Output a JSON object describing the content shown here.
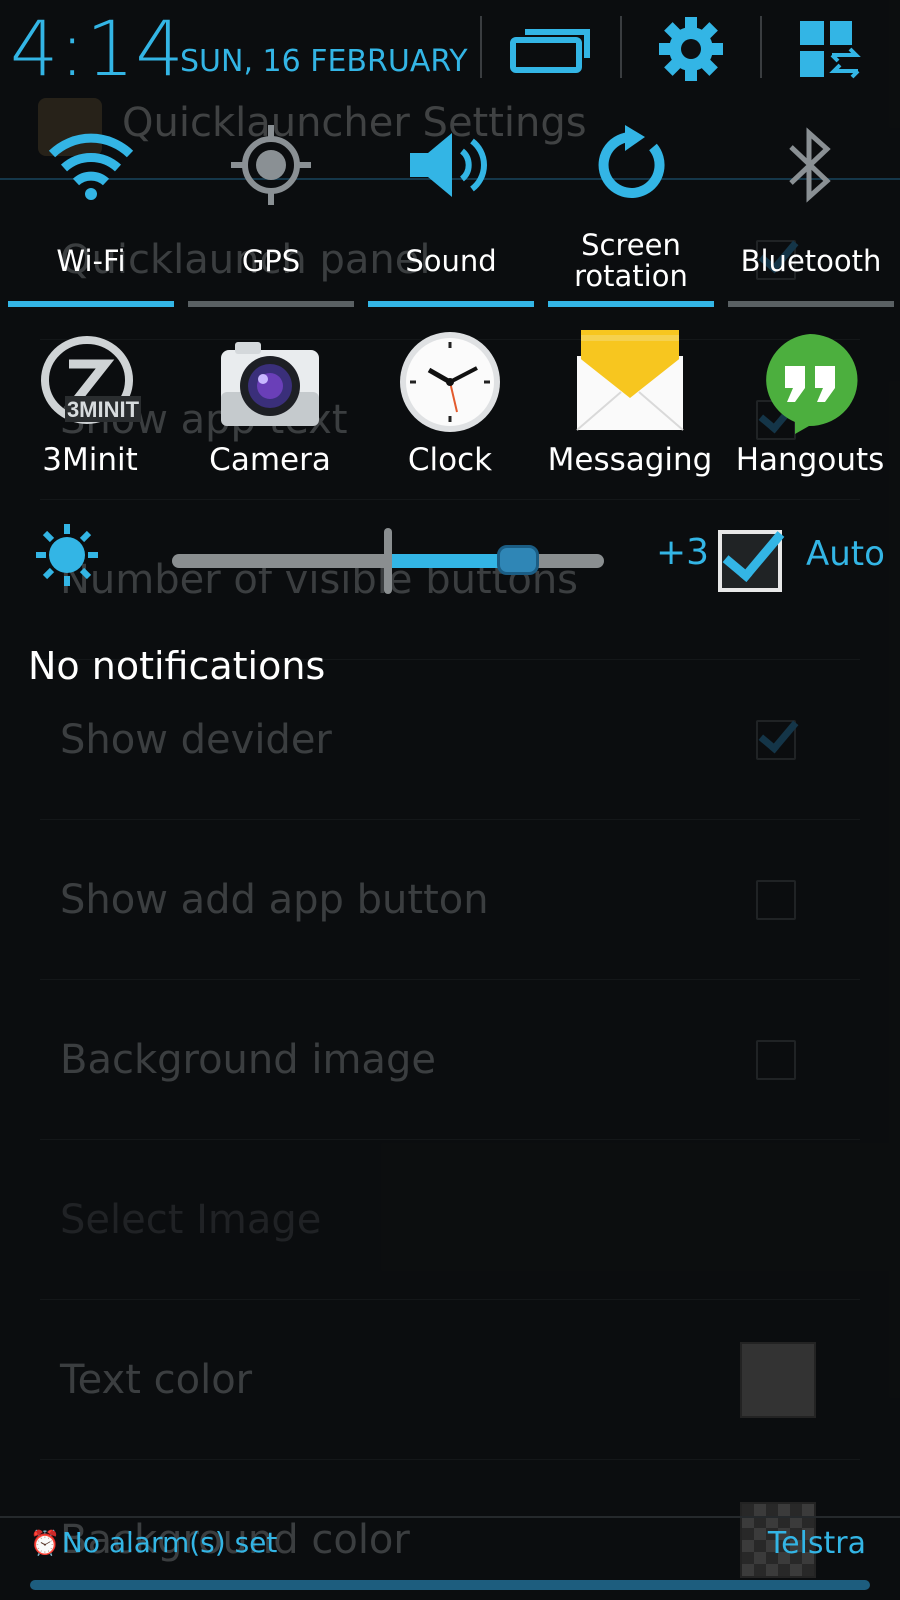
{
  "status": {
    "time": "4:14",
    "date": "SUN, 16 FEBRUARY"
  },
  "header_buttons": [
    {
      "icon": "recent-apps-icon"
    },
    {
      "icon": "gear-icon"
    },
    {
      "icon": "quick-settings-grid-icon"
    }
  ],
  "toggles": [
    {
      "label": "Wi-Fi",
      "icon": "wifi-icon",
      "on": true
    },
    {
      "label": "GPS",
      "icon": "gps-icon",
      "on": false
    },
    {
      "label": "Sound",
      "icon": "sound-icon",
      "on": true
    },
    {
      "label": "Screen\nrotation",
      "icon": "rotation-icon",
      "on": true
    },
    {
      "label": "Bluetooth",
      "icon": "bluetooth-icon",
      "on": false
    }
  ],
  "apps": [
    {
      "label": "3Minit",
      "icon": "3minit-icon"
    },
    {
      "label": "Camera",
      "icon": "camera-icon"
    },
    {
      "label": "Clock",
      "icon": "clock-icon"
    },
    {
      "label": "Messaging",
      "icon": "messaging-icon"
    },
    {
      "label": "Hangouts",
      "icon": "hangouts-icon"
    }
  ],
  "brightness": {
    "value_label": "+3",
    "level": 0.8,
    "auto_checked": true,
    "auto_label": "Auto"
  },
  "notifications": {
    "empty_text": "No notifications"
  },
  "footer": {
    "alarm_text": "No alarm(s) set",
    "carrier": "Telstra"
  },
  "background_app": {
    "title": "Quicklauncher Settings",
    "rows": [
      {
        "label": "Quicklaunch panel",
        "control": "check",
        "checked": true
      },
      {
        "label": "Show app text",
        "control": "check",
        "checked": true
      },
      {
        "label": "Number of visible buttons",
        "control": "none"
      },
      {
        "label": "Show devider",
        "control": "check",
        "checked": true
      },
      {
        "label": "Show add app button",
        "control": "check",
        "checked": false
      },
      {
        "label": "Background image",
        "control": "check",
        "checked": false
      },
      {
        "label": "Select Image",
        "control": "none",
        "disabled": true
      },
      {
        "label": "Text color",
        "control": "swatch-text"
      },
      {
        "label": "Background color",
        "control": "swatch-bg"
      }
    ]
  },
  "colors": {
    "accent": "#33b5e5",
    "shade_bg": "#0d1013"
  }
}
